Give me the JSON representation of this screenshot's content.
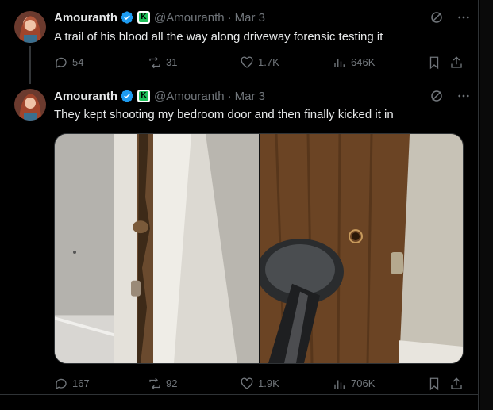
{
  "tweets": [
    {
      "name": "Amouranth",
      "handle": "@Amouranth",
      "separator": "·",
      "date": "Mar 3",
      "text": "A trail of his blood all the way along driveway forensic testing it",
      "stats": {
        "replies": "54",
        "reposts": "31",
        "likes": "1.7K",
        "views": "646K"
      }
    },
    {
      "name": "Amouranth",
      "handle": "@Amouranth",
      "separator": "·",
      "date": "Mar 3",
      "text": "They kept shooting my bedroom door and then finally kicked it in",
      "stats": {
        "replies": "167",
        "reposts": "92",
        "likes": "1.9K",
        "views": "706K"
      }
    }
  ],
  "colors": {
    "background": "#000000",
    "text": "#e7e9ea",
    "muted": "#71767b",
    "verified": "#1d9bf0",
    "kick_green": "#1fc05a"
  },
  "icons": [
    "verified-icon",
    "kick-badge-icon",
    "grok-icon",
    "more-icon",
    "reply-icon",
    "repost-icon",
    "like-icon",
    "views-icon",
    "bookmark-icon",
    "share-icon"
  ]
}
